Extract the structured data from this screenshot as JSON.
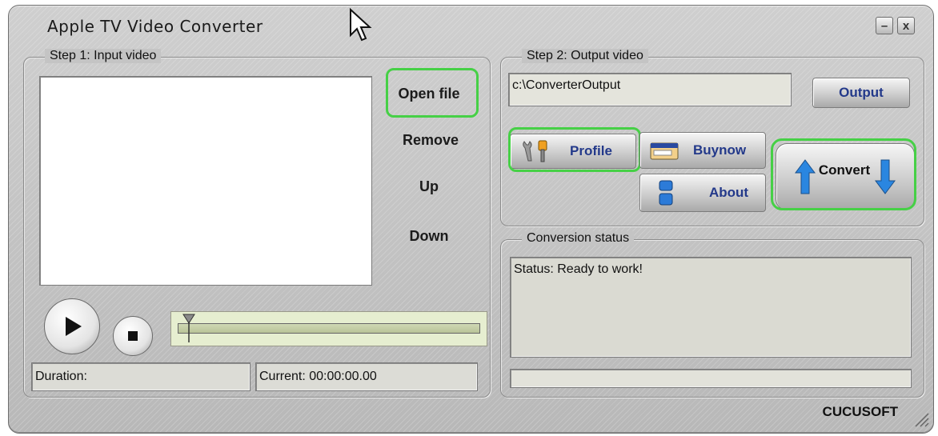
{
  "app": {
    "title": "Apple TV Video Converter",
    "brand": "CUCUSOFT"
  },
  "window_controls": {
    "minimize": "–",
    "close": "x"
  },
  "step1": {
    "legend": "Step 1: Input video",
    "buttons": {
      "open_file": "Open file",
      "remove": "Remove",
      "up": "Up",
      "down": "Down"
    },
    "duration_label": "Duration:",
    "current_label": "Current: 00:00:00.00",
    "progress": 0
  },
  "step2": {
    "legend": "Step 2: Output video",
    "output_path": "c:\\ConverterOutput",
    "output_button": "Output",
    "profile_button": "Profile",
    "buynow_button": "Buynow",
    "about_button": "About",
    "convert_button": "Convert"
  },
  "status": {
    "legend": "Conversion status",
    "text": "Status: Ready to work!",
    "progress": 0
  },
  "colors": {
    "highlight": "#46d046",
    "button_text": "#23398a"
  }
}
